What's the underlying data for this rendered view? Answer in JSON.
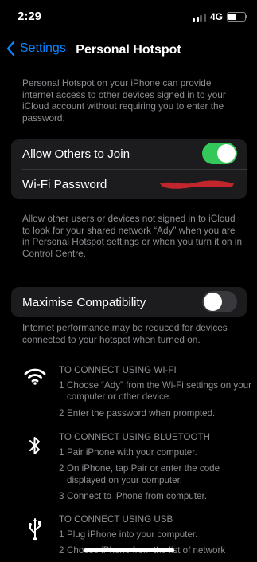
{
  "status": {
    "time": "2:29",
    "network": "4G",
    "battery_level": 0.55
  },
  "nav": {
    "back_label": "Settings",
    "title": "Personal Hotspot"
  },
  "intro_text": "Personal Hotspot on your iPhone can provide internet access to other devices signed in to your iCloud account without requiring you to enter the password.",
  "group1": {
    "allow_label": "Allow Others to Join",
    "allow_on": true,
    "wifi_label": "Wi-Fi Password",
    "wifi_value_redacted": true
  },
  "allow_note": "Allow other users or devices not signed in to iCloud to look for your shared network “Ady” when you are in Personal Hotspot settings or when you turn it on in Control Centre.",
  "group2": {
    "compat_label": "Maximise Compatibility",
    "compat_on": false
  },
  "compat_note": "Internet performance may be reduced for devices connected to your hotspot when turned on.",
  "wifi_section": {
    "heading": "TO CONNECT USING WI-FI",
    "steps": [
      {
        "n": "1",
        "text": "Choose “Ady” from the Wi-Fi settings on your computer or other device."
      },
      {
        "n": "2",
        "text": "Enter the password when prompted."
      }
    ]
  },
  "bt_section": {
    "heading": "TO CONNECT USING BLUETOOTH",
    "steps": [
      {
        "n": "1",
        "text": "Pair iPhone with your computer."
      },
      {
        "n": "2",
        "text": "On iPhone, tap Pair or enter the code displayed on your computer."
      },
      {
        "n": "3",
        "text": "Connect to iPhone from computer."
      }
    ]
  },
  "usb_section": {
    "heading": "TO CONNECT USING USB",
    "steps": [
      {
        "n": "1",
        "text": "Plug iPhone into your computer."
      },
      {
        "n": "2",
        "text": "Choose iPhone from the list of network"
      }
    ]
  },
  "colors": {
    "accent": "#0a84ff",
    "toggle_on": "#34c759",
    "redaction": "#c0262b",
    "cell_bg": "#1c1c1e"
  },
  "icons": {
    "wifi": "wifi-icon",
    "bluetooth": "bluetooth-icon",
    "usb": "usb-icon",
    "back": "chevron-left-icon"
  }
}
